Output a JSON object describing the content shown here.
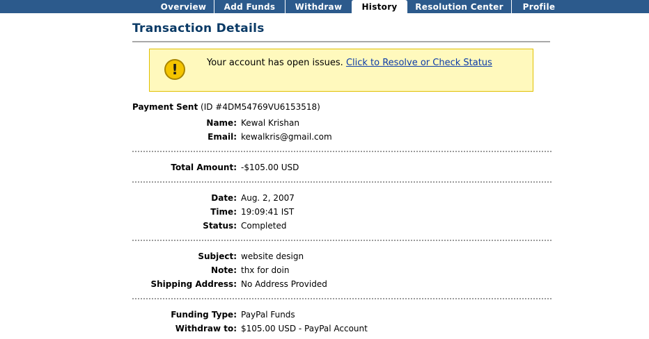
{
  "nav": {
    "tabs": [
      {
        "label": "Overview",
        "active": false
      },
      {
        "label": "Add Funds",
        "active": false
      },
      {
        "label": "Withdraw",
        "active": false
      },
      {
        "label": "History",
        "active": true
      },
      {
        "label": "Resolution Center",
        "active": false
      },
      {
        "label": "Profile",
        "active": false
      }
    ]
  },
  "page_title": "Transaction Details",
  "alert": {
    "icon": "exclamation-icon",
    "message": "Your account has open issues.",
    "link_text": "Click to Resolve or Check Status"
  },
  "payment": {
    "type": "Payment Sent",
    "id": "(ID #4DM54769VU6153518)"
  },
  "details": {
    "name": {
      "label": "Name:",
      "value": "Kewal Krishan"
    },
    "email": {
      "label": "Email:",
      "value": "kewalkris@gmail.com"
    },
    "total": {
      "label": "Total Amount:",
      "value": "-$105.00 USD"
    },
    "date": {
      "label": "Date:",
      "value": "Aug. 2, 2007"
    },
    "time": {
      "label": "Time:",
      "value": "19:09:41 IST"
    },
    "status": {
      "label": "Status:",
      "value": "Completed"
    },
    "subject": {
      "label": "Subject:",
      "value": "website design"
    },
    "note": {
      "label": "Note:",
      "value": "thx for doin"
    },
    "shipping": {
      "label": "Shipping Address:",
      "value": "No Address Provided"
    },
    "funding": {
      "label": "Funding Type:",
      "value": "PayPal Funds"
    },
    "withdraw_to": {
      "label": "Withdraw to:",
      "value": "$105.00 USD - PayPal Account"
    }
  },
  "colors": {
    "nav_bg": "#2c5a8c",
    "title": "#0a3a66",
    "alert_bg": "#fff9bd",
    "alert_border": "#e0c000",
    "link": "#0b3ba8"
  }
}
